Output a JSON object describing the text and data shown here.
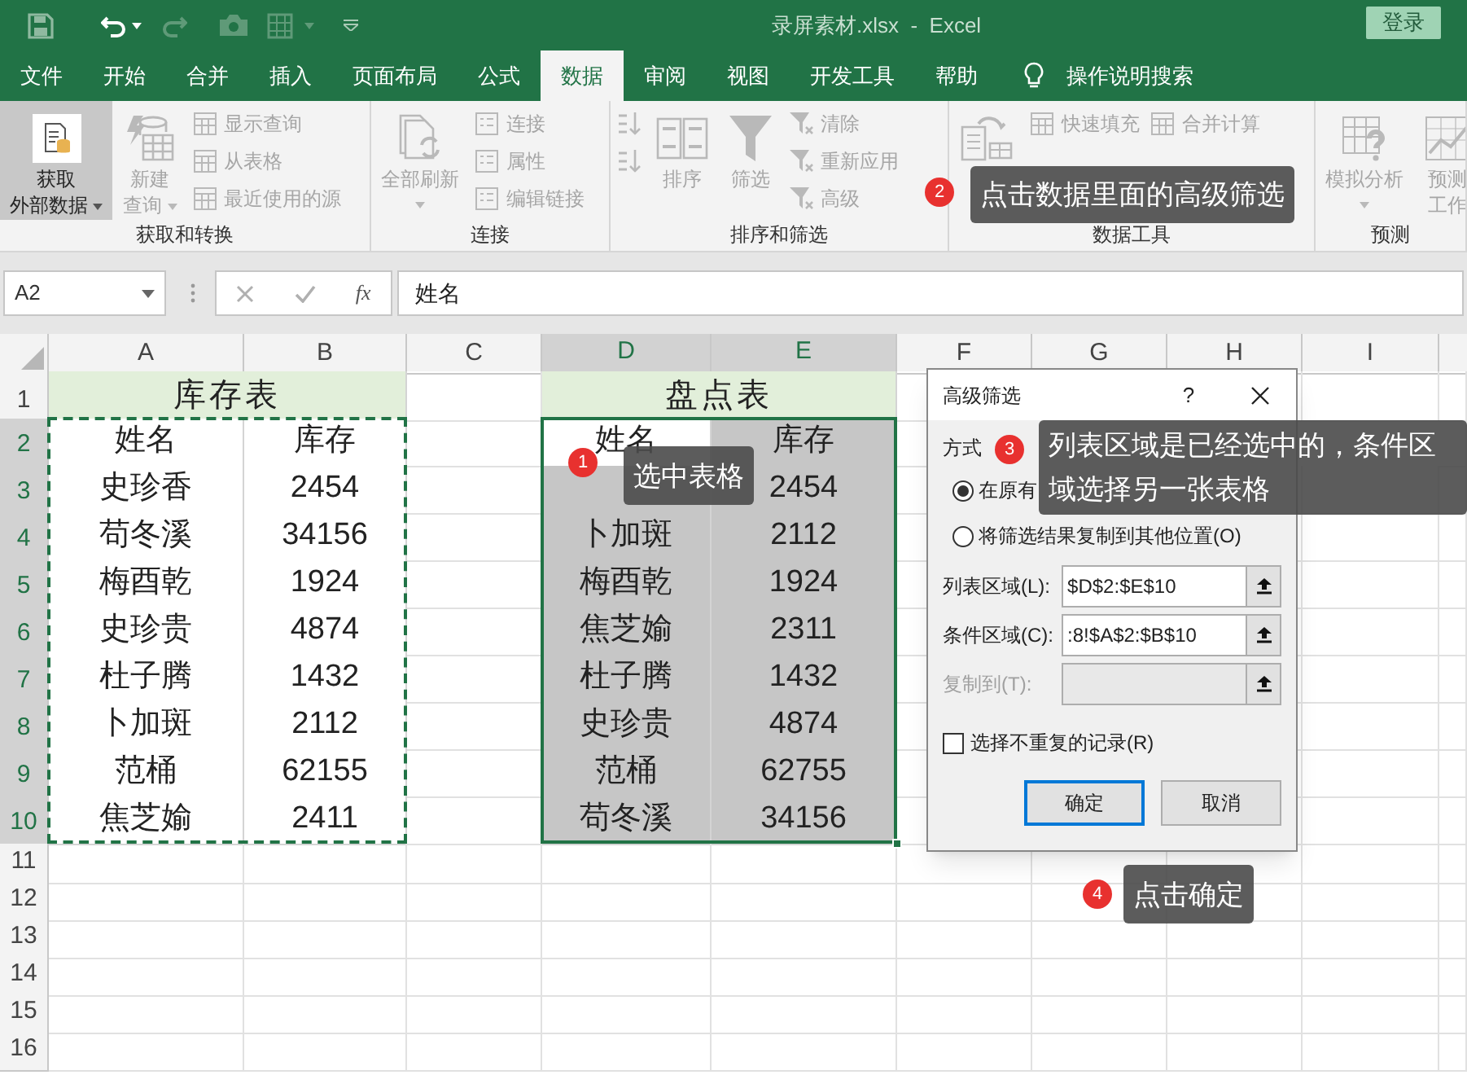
{
  "window": {
    "title": "录屏素材.xlsx  -  Excel",
    "sign_in": "登录"
  },
  "tabs": [
    {
      "label": "文件",
      "selected": false
    },
    {
      "label": "开始",
      "selected": false
    },
    {
      "label": "合并",
      "selected": false
    },
    {
      "label": "插入",
      "selected": false
    },
    {
      "label": "页面布局",
      "selected": false
    },
    {
      "label": "公式",
      "selected": false
    },
    {
      "label": "数据",
      "selected": true
    },
    {
      "label": "审阅",
      "selected": false
    },
    {
      "label": "视图",
      "selected": false
    },
    {
      "label": "开发工具",
      "selected": false
    },
    {
      "label": "帮助",
      "selected": false
    }
  ],
  "tell_me": "操作说明搜索",
  "ribbon": [
    {
      "label": "获取和转换",
      "items": [
        {
          "kind": "large",
          "lines": [
            "获取",
            "外部数据"
          ],
          "dropdown": true,
          "disabled": false,
          "hovered": true
        },
        {
          "kind": "large",
          "lines": [
            "新建",
            "查询"
          ],
          "dropdown": true,
          "disabled": true,
          "hovered": false
        },
        {
          "kind": "stack",
          "entries": [
            {
              "label": "显示查询",
              "disabled": true
            },
            {
              "label": "从表格",
              "disabled": true
            },
            {
              "label": "最近使用的源",
              "disabled": true
            }
          ]
        }
      ]
    },
    {
      "label": "连接",
      "items": [
        {
          "kind": "large",
          "lines": [
            "全部刷新"
          ],
          "dropdown": true,
          "disabled": true,
          "hovered": false
        },
        {
          "kind": "stack",
          "entries": [
            {
              "label": "连接",
              "disabled": true
            },
            {
              "label": "属性",
              "disabled": true
            },
            {
              "label": "编辑链接",
              "disabled": true
            }
          ]
        }
      ]
    },
    {
      "label": "排序和筛选",
      "items": [
        {
          "kind": "stack",
          "entries": [
            {
              "disabled": true
            },
            {
              "disabled": true
            }
          ]
        },
        {
          "kind": "large",
          "lines": [
            "排序"
          ],
          "dropdown": false,
          "disabled": true,
          "hovered": false
        },
        {
          "kind": "large",
          "lines": [
            "筛选"
          ],
          "dropdown": false,
          "disabled": true,
          "hovered": false
        },
        {
          "kind": "stack",
          "entries": [
            {
              "label": "清除",
              "disabled": true
            },
            {
              "label": "重新应用",
              "disabled": true
            },
            {
              "label": "高级",
              "disabled": true
            }
          ]
        }
      ]
    },
    {
      "label": "数据工具",
      "items": [
        {
          "kind": "large",
          "disabled": true,
          "hovered": false
        },
        {
          "kind": "stack",
          "entries": [
            {
              "label": "快速填充",
              "disabled": true
            }
          ]
        },
        {
          "kind": "stack",
          "entries": [
            {
              "label": "合并计算",
              "disabled": true
            }
          ]
        }
      ]
    },
    {
      "label": "预测",
      "items": [
        {
          "kind": "large",
          "lines": [
            "模拟分析"
          ],
          "dropdown": true,
          "disabled": true,
          "hovered": false
        },
        {
          "kind": "large",
          "lines": [
            "预测",
            "工作"
          ],
          "dropdown": false,
          "disabled": true,
          "hovered": false
        }
      ]
    }
  ],
  "formula_bar": {
    "name_box": "A2",
    "function_label": "fx",
    "value": "姓名"
  },
  "sheet": {
    "columns": [
      {
        "label": "A",
        "selected": false
      },
      {
        "label": "B",
        "selected": false
      },
      {
        "label": "C",
        "selected": false
      },
      {
        "label": "D",
        "selected": true
      },
      {
        "label": "E",
        "selected": true
      },
      {
        "label": "F",
        "selected": false
      },
      {
        "label": "G",
        "selected": false
      },
      {
        "label": "H",
        "selected": false
      },
      {
        "label": "I",
        "selected": false
      }
    ],
    "rows": [
      {
        "label": "1",
        "selected": false
      },
      {
        "label": "2",
        "selected": true
      },
      {
        "label": "3",
        "selected": true
      },
      {
        "label": "4",
        "selected": true
      },
      {
        "label": "5",
        "selected": true
      },
      {
        "label": "6",
        "selected": true
      },
      {
        "label": "7",
        "selected": true
      },
      {
        "label": "8",
        "selected": true
      },
      {
        "label": "9",
        "selected": true
      },
      {
        "label": "10",
        "selected": true
      },
      {
        "label": "11",
        "selected": false
      },
      {
        "label": "12",
        "selected": false
      },
      {
        "label": "13",
        "selected": false
      },
      {
        "label": "14",
        "selected": false
      },
      {
        "label": "15",
        "selected": false
      },
      {
        "label": "16",
        "selected": false
      }
    ],
    "tables": [
      {
        "title": "库存表",
        "columns": [
          "姓名",
          "库存"
        ],
        "copied": true,
        "selected": false,
        "rows": [
          [
            "史珍香",
            "2454"
          ],
          [
            "苟冬溪",
            "34156"
          ],
          [
            "梅酉乾",
            "1924"
          ],
          [
            "史珍贵",
            "4874"
          ],
          [
            "杜子腾",
            "1432"
          ],
          [
            "卜加斑",
            "2112"
          ],
          [
            "范桶",
            "62155"
          ],
          [
            "焦芝媮",
            "2411"
          ]
        ]
      },
      {
        "title": "盘点表",
        "columns": [
          "姓名",
          "库存"
        ],
        "copied": false,
        "selected": true,
        "rows": [
          [
            null,
            "2454"
          ],
          [
            "卜加斑",
            "2112"
          ],
          [
            "梅酉乾",
            "1924"
          ],
          [
            "焦芝媮",
            "2311"
          ],
          [
            "杜子腾",
            "1432"
          ],
          [
            "史珍贵",
            "4874"
          ],
          [
            "范桶",
            "62755"
          ],
          [
            "苟冬溪",
            "34156"
          ]
        ]
      }
    ]
  },
  "dialog": {
    "title": "高级筛选",
    "help": "?",
    "section": "方式",
    "options": [
      {
        "label": "在原有",
        "selected": true
      },
      {
        "label": "将筛选结果复制到其他位置(O)",
        "selected": false
      }
    ],
    "fields": [
      {
        "label": "列表区域(L):",
        "value": "$D$2:$E$10",
        "disabled": false
      },
      {
        "label": "条件区域(C):",
        "value": ":8!$A$2:$B$10",
        "disabled": false
      },
      {
        "label": "复制到(T):",
        "disabled": true
      }
    ],
    "checkbox": {
      "label": "选择不重复的记录(R)",
      "checked": false
    },
    "buttons": [
      {
        "label": "确定",
        "default": true
      },
      {
        "label": "取消",
        "default": false
      }
    ]
  },
  "callouts": [
    {
      "number": "1",
      "text": "选中表格"
    },
    {
      "number": "2",
      "text": "点击数据里面的高级筛选"
    },
    {
      "number": "3",
      "text": "列表区域是已经选中的，条件区域选择另一张表格"
    },
    {
      "number": "4",
      "text": "点击确定"
    }
  ]
}
